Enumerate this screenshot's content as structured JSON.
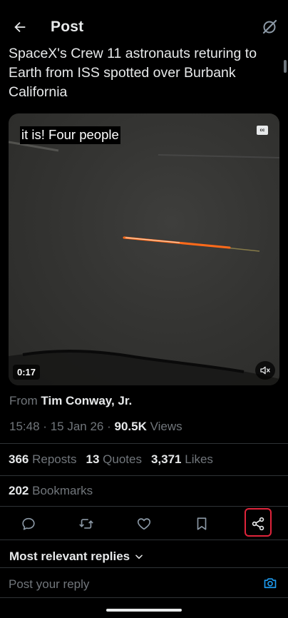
{
  "header": {
    "title": "Post"
  },
  "post": {
    "text": "SpaceX's Crew 11 astronauts returing to Earth from ISS spotted over Burbank California",
    "video": {
      "caption": "it is! Four people",
      "cc_label": "cc",
      "duration": "0:17"
    },
    "from_prefix": "From",
    "author": "Tim Conway, Jr.",
    "time": "15:48",
    "date": "15 Jan 26",
    "views_count": "90.5K",
    "views_label": "Views",
    "separator": "·"
  },
  "stats": {
    "reposts_count": "366",
    "reposts_label": "Reposts",
    "quotes_count": "13",
    "quotes_label": "Quotes",
    "likes_count": "3,371",
    "likes_label": "Likes",
    "bookmarks_count": "202",
    "bookmarks_label": "Bookmarks"
  },
  "actions": [
    "reply-icon",
    "repost-icon",
    "like-icon",
    "bookmark-icon",
    "share-icon"
  ],
  "replies": {
    "sort_label": "Most relevant replies",
    "reply_placeholder": "Post your reply"
  },
  "colors": {
    "background": "#000000",
    "text_primary": "#e7e9ea",
    "text_secondary": "#71767b",
    "accent": "#1d9bf0",
    "highlight": "#e0243b"
  }
}
